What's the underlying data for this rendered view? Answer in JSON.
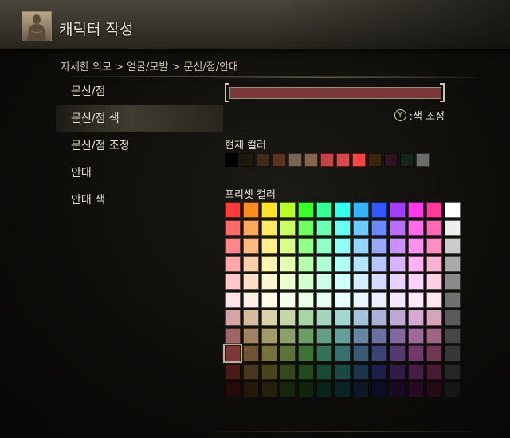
{
  "header": {
    "title": "캐릭터 작성",
    "avatar_icon": "character-portrait-icon"
  },
  "breadcrumb": "자세한 외모 > 얼굴/모발 > 문신/점/안대",
  "menu": {
    "items": [
      {
        "label": "문신/점"
      },
      {
        "label": "문신/점 색",
        "selected": true
      },
      {
        "label": "문신/점 조정"
      },
      {
        "label": "안대"
      },
      {
        "label": "안대 색"
      }
    ]
  },
  "panel": {
    "selected_color": "#7a3838",
    "adjust_button_glyph": "Y",
    "adjust_label": ":색 조정",
    "current_label": "현재 컬러",
    "preset_label": "프리셋 컬러",
    "current_colors": [
      "#000000",
      "#20180f",
      "#3f2b1e",
      "#5c3322",
      "#7a6552",
      "#86654c",
      "#c84245",
      "#d8494b",
      "#ff4242",
      "#3c2409",
      "#2a1420",
      "#162419",
      "#6c6c6c"
    ],
    "preset_colors": [
      [
        "#ff3b3b",
        "#ff8a1e",
        "#ffe326",
        "#b7ff2b",
        "#39ff2d",
        "#35ff95",
        "#34fff0",
        "#34b5ff",
        "#3458ff",
        "#a23dff",
        "#ff38e8",
        "#ff3a9a",
        "#ffffff"
      ],
      [
        "#ff6a6a",
        "#ffa75a",
        "#ffea63",
        "#caff62",
        "#6fff65",
        "#6bffb1",
        "#6afff4",
        "#6ccaff",
        "#6b88ff",
        "#ba6dff",
        "#ff6cec",
        "#ff6ab3",
        "#eeeeee"
      ],
      [
        "#ff8989",
        "#ffbb82",
        "#ffef8b",
        "#d7ff8a",
        "#93ff8b",
        "#8fffc4",
        "#90fff6",
        "#93d6ff",
        "#9aa9ff",
        "#ca92ff",
        "#ff92f0",
        "#ff8ec2",
        "#cccccc"
      ],
      [
        "#ffa8a8",
        "#ffcea6",
        "#fff4ae",
        "#e3ffad",
        "#b5ffae",
        "#b0ffd6",
        "#b1fff9",
        "#b4e3ff",
        "#b8c4ff",
        "#d9b3ff",
        "#ffb3f4",
        "#ffb0d3",
        "#aaaaaa"
      ],
      [
        "#ffc8c8",
        "#ffdfc8",
        "#fff8cf",
        "#eeffcf",
        "#d3ffcf",
        "#cfffe6",
        "#d0fffb",
        "#d2eeff",
        "#d6dcff",
        "#e7d2ff",
        "#ffd2f8",
        "#ffcfe3",
        "#8a8a8a"
      ],
      [
        "#ffe5e5",
        "#ffefe4",
        "#fffbe8",
        "#f6ffe9",
        "#eaffe8",
        "#e8fff3",
        "#e8fffd",
        "#e9f6ff",
        "#ebeeff",
        "#f2e9ff",
        "#ffe9fb",
        "#ffe7f1",
        "#707070"
      ],
      [
        "#d6a5a5",
        "#d7bba1",
        "#d9d3a5",
        "#c7d6a4",
        "#a9d6a3",
        "#a4d6bd",
        "#a4d6d2",
        "#a6c4d8",
        "#aab2d8",
        "#bfa9d7",
        "#d5a8d0",
        "#d7a5ba",
        "#5a5a5a"
      ],
      [
        "#a06666",
        "#a08162",
        "#a29b67",
        "#8c9f66",
        "#6b9e65",
        "#659e83",
        "#659d99",
        "#66869f",
        "#6a72a0",
        "#82689f",
        "#9e6899",
        "#a0657f",
        "#464646"
      ],
      [
        "#7a3838",
        "#6e5433",
        "#76703a",
        "#5c7338",
        "#3f7237",
        "#377256",
        "#37706c",
        "#385a73",
        "#3b4373",
        "#553a72",
        "#71396b",
        "#713652",
        "#373737"
      ],
      [
        "#4a1a1a",
        "#47351d",
        "#48441d",
        "#36481b",
        "#22481b",
        "#1b4833",
        "#1b4744",
        "#1c3448",
        "#1c2049",
        "#321c47",
        "#471c43",
        "#471b32",
        "#262626"
      ],
      [
        "#250a0a",
        "#24180a",
        "#24210a",
        "#1a240a",
        "#0f240a",
        "#0a2417",
        "#0a2421",
        "#0a1924",
        "#0b0c25",
        "#170b24",
        "#240b21",
        "#240a17",
        "#161616"
      ]
    ],
    "preset_selected": [
      8,
      0
    ]
  }
}
